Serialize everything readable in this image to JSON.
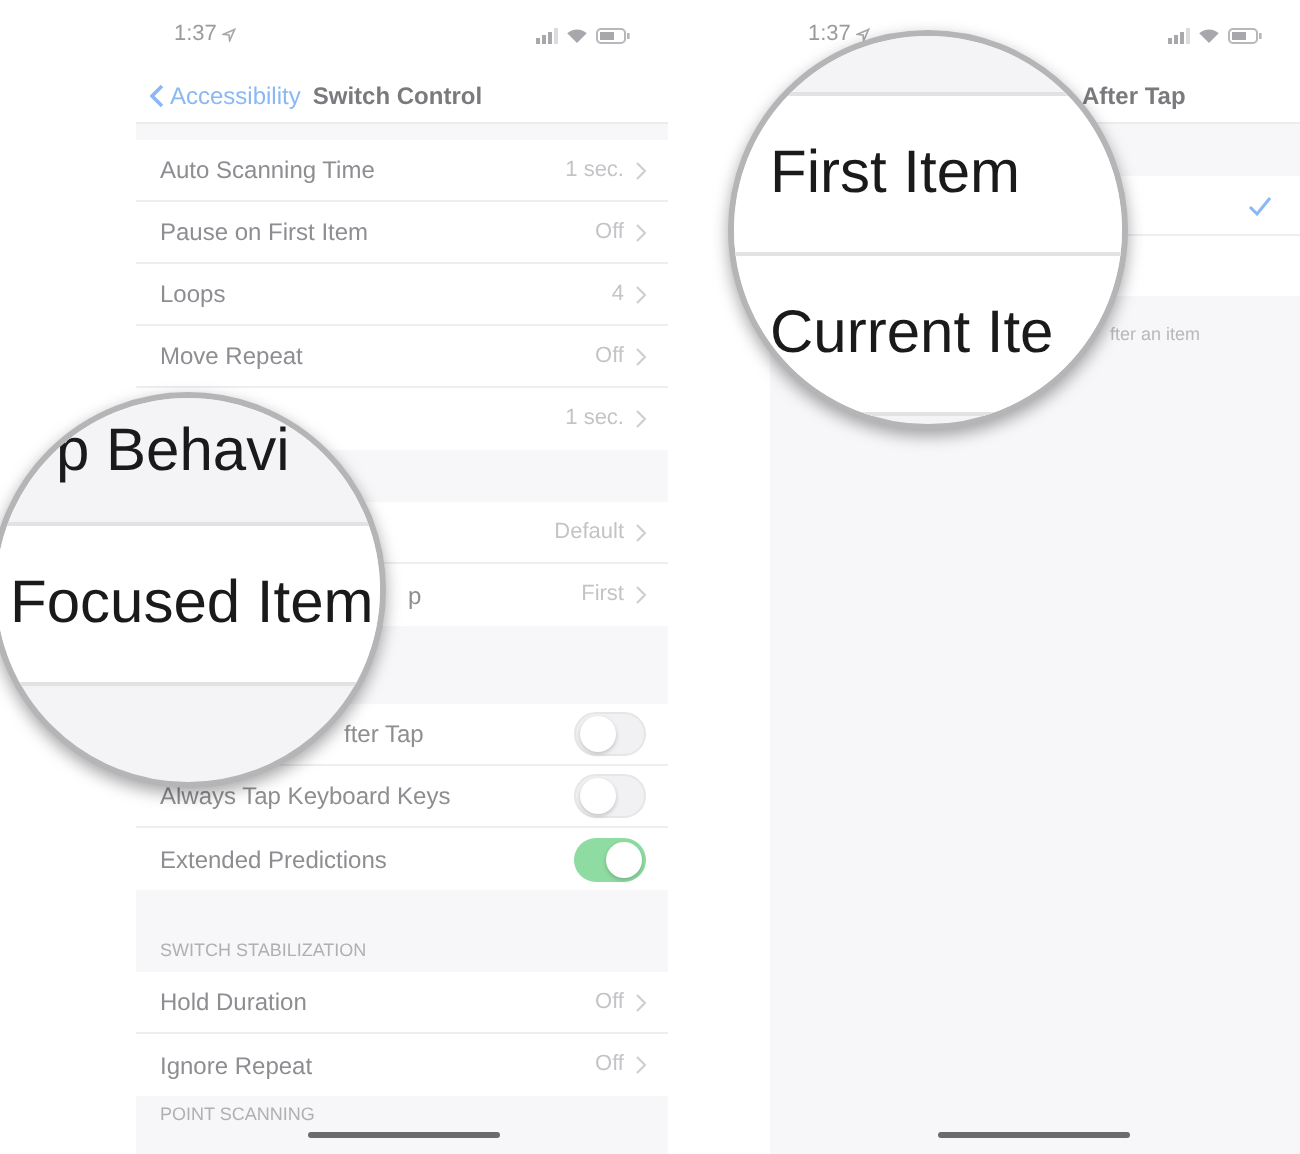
{
  "left_screen": {
    "status_bar": {
      "time": "1:37"
    },
    "nav": {
      "back": "Accessibility",
      "title": "Switch Control"
    },
    "groups": [
      {
        "rows": [
          {
            "kind": "value",
            "label": "Auto Scanning Time",
            "value": "1 sec."
          },
          {
            "kind": "value",
            "label": "Pause on First Item",
            "value": "Off"
          },
          {
            "kind": "value",
            "label": "Loops",
            "value": "4"
          },
          {
            "kind": "value",
            "label": "Move Repeat",
            "value": "Off"
          },
          {
            "kind": "value",
            "value": "1 sec."
          }
        ]
      },
      {
        "rows": [
          {
            "kind": "value",
            "value": "Default"
          },
          {
            "kind": "value",
            "label": "p",
            "covered": true,
            "value": "First"
          }
        ]
      },
      {
        "rows": [
          {
            "kind": "toggle",
            "label": "fter Tap",
            "covered": true,
            "on": false
          },
          {
            "kind": "toggle",
            "label": "Always Tap Keyboard Keys",
            "on": false
          },
          {
            "kind": "toggle",
            "label": "Extended Predictions",
            "on": true
          }
        ]
      },
      {
        "header": "SWITCH STABILIZATION",
        "rows": [
          {
            "kind": "value",
            "label": "Hold Duration",
            "value": "Off"
          },
          {
            "kind": "value",
            "label": "Ignore Repeat",
            "value": "Off"
          }
        ]
      },
      {
        "header": "POINT SCANNING"
      }
    ]
  },
  "left_magnifier": {
    "lines": [
      "p Behavi",
      "Focused Item"
    ]
  },
  "right_screen": {
    "status_bar": {
      "time": "1:37"
    },
    "nav": {
      "title": "After Tap"
    },
    "options": [
      {
        "selected": true
      },
      {
        "selected": false
      }
    ],
    "footer": "fter an item"
  },
  "right_magnifier": {
    "lines": [
      "First Item",
      "Current Ite"
    ]
  }
}
